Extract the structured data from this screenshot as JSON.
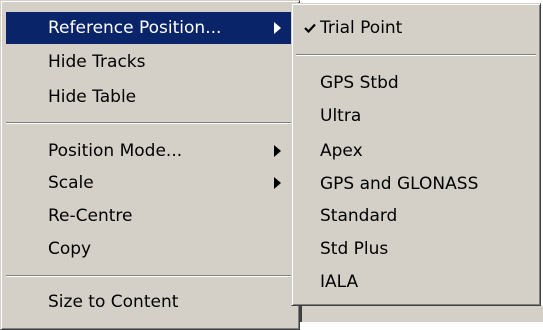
{
  "main_menu": {
    "reference_position": "Reference Position...",
    "hide_tracks": "Hide Tracks",
    "hide_table": "Hide Table",
    "position_mode": "Position Mode...",
    "scale": "Scale",
    "re_centre": "Re-Centre",
    "copy": "Copy",
    "size_to_content": "Size to Content"
  },
  "sub_menu": {
    "selected": "Trial Point",
    "items": [
      "Trial Point",
      "GPS Stbd",
      "Ultra",
      "Apex",
      "GPS and GLONASS",
      "Standard",
      "Std Plus",
      "IALA"
    ]
  },
  "colors": {
    "menu_bg": "#d4d0c8",
    "highlight": "#0a246a"
  },
  "icons": {
    "check": "check-icon",
    "submenu_arrow": "submenu-arrow-icon"
  }
}
